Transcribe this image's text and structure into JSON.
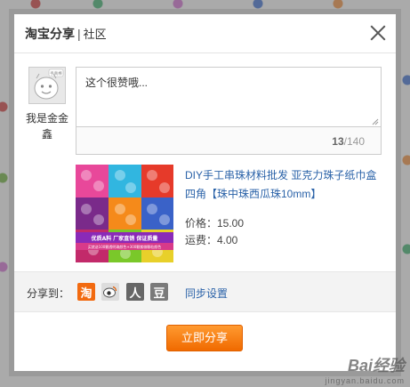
{
  "dialog": {
    "title_main": "淘宝分享",
    "title_sep": "|",
    "title_sub": "社区"
  },
  "user": {
    "name": "我是金金鑫",
    "avatar_label": "手真棒"
  },
  "comment": {
    "text": "这个很赞哦...",
    "count": "13",
    "max": "/140"
  },
  "product": {
    "title": "DIY手工串珠材料批发 亚克力珠子纸巾盒四角【珠中珠西瓜珠10mm】",
    "price": "价格：15.00",
    "shipping": "运费：4.00",
    "banner_line1": "优质A料  厂家直销  保证质量",
    "banner_line2": "买就送100颗透明珠颜色+300颗紫微颗粒颜色"
  },
  "share": {
    "label": "分享到：",
    "taobao_glyph": "淘",
    "renren_glyph": "人",
    "douban_glyph": "豆",
    "sync_label": "同步设置"
  },
  "submit_label": "立即分享",
  "watermark": {
    "main": "Bai经验",
    "sub": "jingyan.baidu.com"
  },
  "colors": {
    "link": "#2a62a8",
    "accent": "#f06a00"
  }
}
